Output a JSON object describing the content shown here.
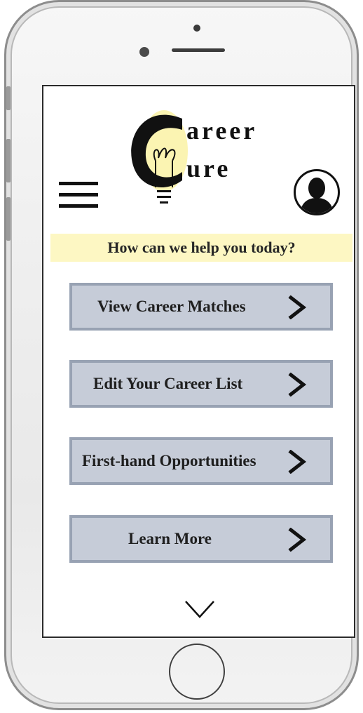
{
  "app": {
    "logo": {
      "line1": "areer",
      "line2": "ure",
      "initial": "C"
    }
  },
  "header": {
    "menu_icon": "hamburger-menu-icon",
    "avatar_icon": "user-silhouette-icon"
  },
  "banner": {
    "text": "How can we help you today?",
    "color": "#fdf7c3"
  },
  "menu": {
    "items": [
      {
        "label": "View Career Matches"
      },
      {
        "label": "Edit Your Career List"
      },
      {
        "label": "First-hand Opportunities"
      },
      {
        "label": "Learn More"
      }
    ],
    "button_color": "#c6ccd8",
    "button_border": "#98a2b3"
  },
  "footer": {
    "scroll_icon": "chevron-down-icon"
  }
}
